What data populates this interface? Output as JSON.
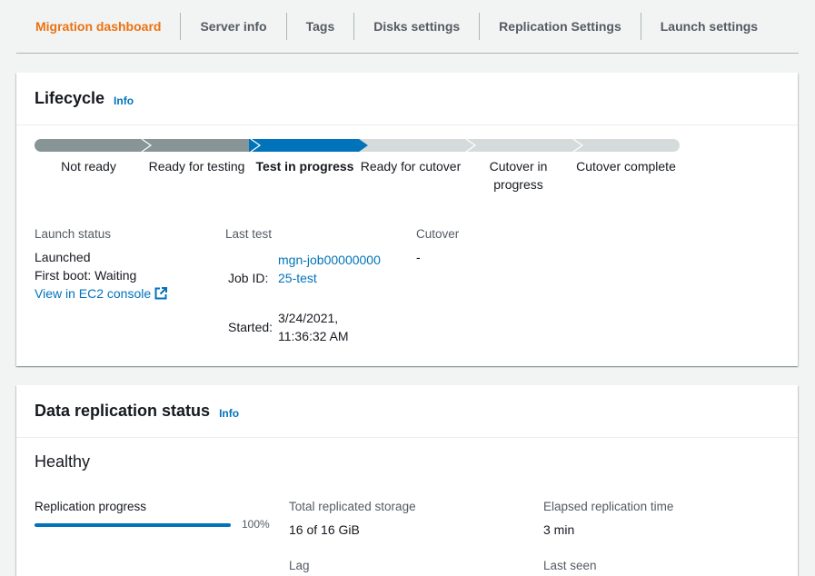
{
  "tabs": [
    {
      "label": "Migration dashboard",
      "active": true
    },
    {
      "label": "Server info"
    },
    {
      "label": "Tags"
    },
    {
      "label": "Disks settings"
    },
    {
      "label": "Replication Settings"
    },
    {
      "label": "Launch settings"
    }
  ],
  "lifecycle": {
    "title": "Lifecycle",
    "info": "Info",
    "steps": [
      {
        "label": "Not ready",
        "state": "done"
      },
      {
        "label": "Ready for testing",
        "state": "done"
      },
      {
        "label": "Test in progress",
        "state": "current"
      },
      {
        "label": "Ready for cutover",
        "state": "pending"
      },
      {
        "label": "Cutover in progress",
        "state": "pending"
      },
      {
        "label": "Cutover complete",
        "state": "pending"
      }
    ],
    "launch_status": {
      "label": "Launch status",
      "status": "Launched",
      "first_boot": "First boot: Waiting",
      "console_link": "View in EC2 console"
    },
    "last_test": {
      "label": "Last test",
      "job_id_label": "Job ID:",
      "job_id": "mgn-job0000000025-test",
      "started_label": "Started:",
      "started": "3/24/2021, 11:36:32 AM"
    },
    "cutover": {
      "label": "Cutover",
      "value": "-"
    }
  },
  "replication": {
    "title": "Data replication status",
    "info": "Info",
    "health": "Healthy",
    "progress_label": "Replication progress",
    "progress_value": 100,
    "progress_text": "100%",
    "total_storage_label": "Total replicated storage",
    "total_storage": "16 of 16 GiB",
    "elapsed_label": "Elapsed replication time",
    "elapsed": "3 min",
    "lag_label": "Lag",
    "last_seen_label": "Last seen"
  },
  "colors": {
    "accent": "#ec7211",
    "link": "#0073bb",
    "done": "#879596",
    "current": "#0073bb",
    "pending": "#d5dbdb"
  }
}
